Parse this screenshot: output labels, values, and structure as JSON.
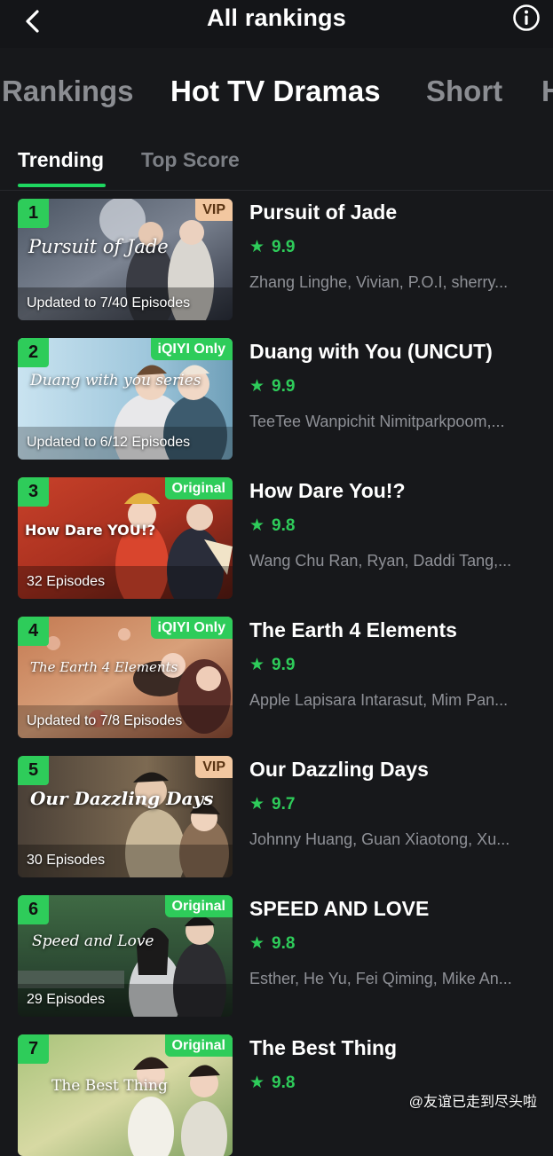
{
  "header": {
    "title": "All rankings",
    "back_icon": "chevron-left-icon",
    "info_icon": "info-icon"
  },
  "category_tabs": [
    "Rankings",
    "Hot TV Dramas",
    "Short",
    "H"
  ],
  "active_category": "Hot TV Dramas",
  "sub_tabs": [
    "Trending",
    "Top Score"
  ],
  "active_sub_tab": "Trending",
  "accent_color": "#2ecc5a",
  "items": [
    {
      "rank": "1",
      "tag": "VIP",
      "thumb_title": "Pursuit of Jade",
      "episodes": "Updated to 7/40 Episodes",
      "title": "Pursuit of Jade",
      "score": "9.9",
      "cast": "Zhang Linghe, Vivian, P.O.I, sherry..."
    },
    {
      "rank": "2",
      "tag": "iQIYI Only",
      "thumb_title": "Duang with you series",
      "episodes": "Updated to 6/12 Episodes",
      "title": "Duang with You (UNCUT)",
      "score": "9.9",
      "cast": "TeeTee Wanpichit Nimitparkpoom,..."
    },
    {
      "rank": "3",
      "tag": "Original",
      "thumb_title": "How Dare YOU!?",
      "episodes": "32 Episodes",
      "title": "How Dare You!?",
      "score": "9.8",
      "cast": "Wang Chu Ran, Ryan, Daddi Tang,..."
    },
    {
      "rank": "4",
      "tag": "iQIYI Only",
      "thumb_title": "The Earth 4 Elements",
      "episodes": "Updated to 7/8 Episodes",
      "title": "The Earth 4 Elements",
      "score": "9.9",
      "cast": "Apple Lapisara Intarasut, Mim Pan..."
    },
    {
      "rank": "5",
      "tag": "VIP",
      "thumb_title": "Our Dazzling Days",
      "episodes": "30 Episodes",
      "title": "Our Dazzling Days",
      "score": "9.7",
      "cast": "Johnny Huang, Guan Xiaotong, Xu..."
    },
    {
      "rank": "6",
      "tag": "Original",
      "thumb_title": "Speed and Love",
      "episodes": "29 Episodes",
      "title": "SPEED AND LOVE",
      "score": "9.8",
      "cast": "Esther, He Yu, Fei Qiming, Mike An..."
    },
    {
      "rank": "7",
      "tag": "Original",
      "thumb_title": "The Best Thing",
      "episodes": "",
      "title": "The Best Thing",
      "score": "9.8",
      "cast": ""
    }
  ],
  "watermark": "@友谊已走到尽头啦"
}
